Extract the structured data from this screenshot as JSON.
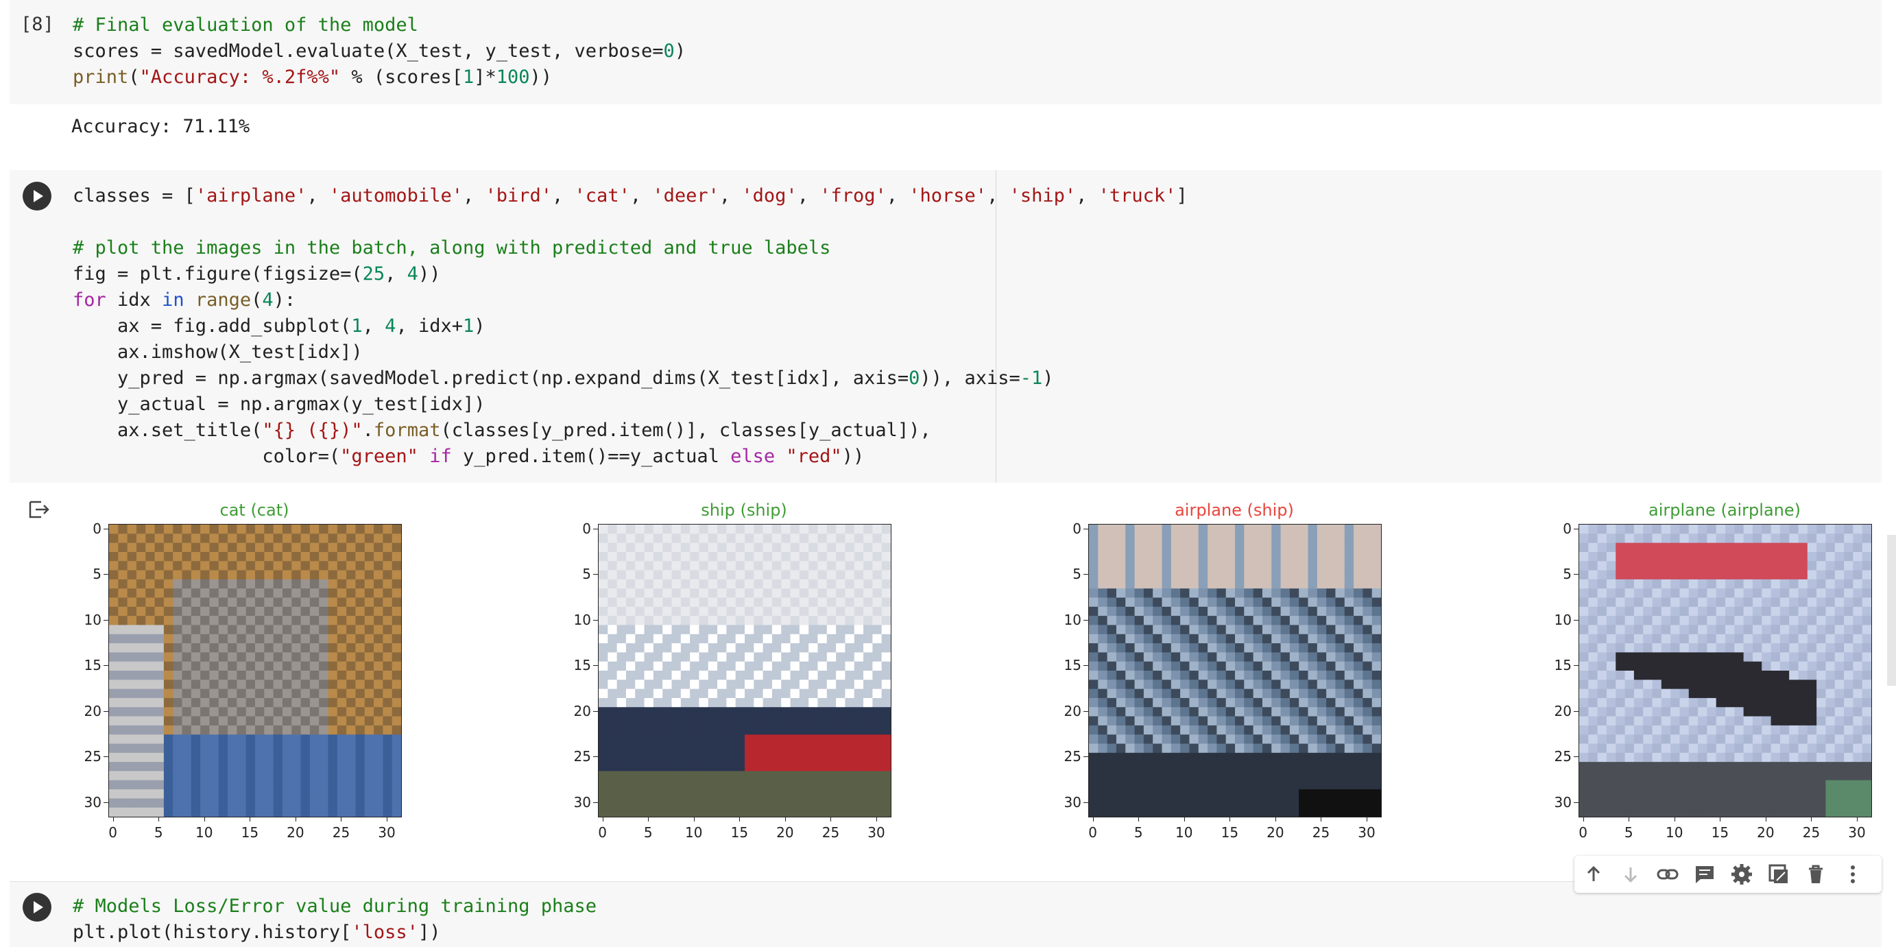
{
  "cell8": {
    "exec_count": "[8]",
    "code": [
      "# Final evaluation of the model",
      "scores = savedModel.evaluate(X_test, y_test, verbose=0)",
      "print(\"Accuracy: %.2f%%\" % (scores[1]*100))"
    ],
    "output": "Accuracy: 71.11%"
  },
  "cell9": {
    "code": [
      "classes = ['airplane', 'automobile', 'bird', 'cat', 'deer', 'dog', 'frog', 'horse', 'ship', 'truck']",
      "",
      "# plot the images in the batch, along with predicted and true labels",
      "fig = plt.figure(figsize=(25, 4))",
      "for idx in range(4):",
      "    ax = fig.add_subplot(1, 4, idx+1)",
      "    ax.imshow(X_test[idx])",
      "    y_pred = np.argmax(savedModel.predict(np.expand_dims(X_test[idx], axis=0)), axis=-1)",
      "    y_actual = np.argmax(y_test[idx])",
      "    ax.set_title(\"{} ({})\".format(classes[y_pred.item()], classes[y_actual]),",
      "                 color=(\"green\" if y_pred.item()==y_actual else \"red\"))"
    ]
  },
  "plots": [
    {
      "title": "cat (cat)",
      "correct": true,
      "color": "#3f9c35"
    },
    {
      "title": "ship (ship)",
      "correct": true,
      "color": "#3f9c35"
    },
    {
      "title": "airplane (ship)",
      "correct": false,
      "color": "#e8453c"
    },
    {
      "title": "airplane (airplane)",
      "correct": true,
      "color": "#3f9c35"
    }
  ],
  "ticks": {
    "y": [
      "0",
      "5",
      "10",
      "15",
      "20",
      "25",
      "30"
    ],
    "x": [
      "0",
      "5",
      "10",
      "15",
      "20",
      "25",
      "30"
    ]
  },
  "cell10": {
    "code": [
      "# Models Loss/Error value during training phase",
      "plt.plot(history.history['loss'])"
    ]
  },
  "toolbar": {
    "icons": [
      "arrow-up-icon",
      "arrow-down-icon",
      "link-icon",
      "comment-icon",
      "gear-icon",
      "mirror-cell-icon",
      "trash-icon",
      "more-vert-icon"
    ]
  },
  "colors": {
    "green": "#3f9c35",
    "red": "#e8453c",
    "comment": "#1a7f1a",
    "string": "#a31515",
    "number": "#098658",
    "keyword": "#a626a4"
  }
}
